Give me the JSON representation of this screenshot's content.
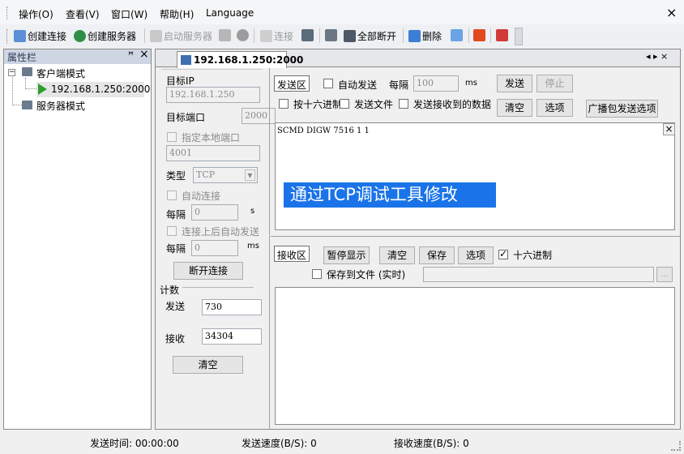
{
  "menu": {
    "items": [
      "操作(O)",
      "查看(V)",
      "窗口(W)",
      "帮助(H)",
      "Language"
    ],
    "close": "×"
  },
  "toolbar": {
    "create_connection": "创建连接",
    "create_server": "创建服务器",
    "start_server": "启动服务器",
    "connect": "连接",
    "disconnect_all": "全部断开",
    "delete": "删除"
  },
  "left_panel": {
    "title": "属性栏",
    "pin": "ꟸ",
    "close": "×",
    "client_mode": "客户端模式",
    "client_item": "192.168.1.250:2000",
    "server_mode": "服务器模式"
  },
  "tab": {
    "label": "192.168.1.250:2000",
    "nav": "◂ ▸ ×"
  },
  "connection": {
    "target_ip_label": "目标IP",
    "target_ip": "192.168.1.250",
    "target_port_label": "目标端口",
    "target_port": "2000",
    "local_port_label": "指定本地端口",
    "local_port": "4001",
    "type_label": "类型",
    "type_value": "TCP",
    "auto_connect_label": "自动连接",
    "interval_label": "每隔",
    "interval_value": "0",
    "interval_unit": "s",
    "auto_send_label": "连接上后自动发送",
    "interval2_label": "每隔",
    "interval2_value": "0",
    "interval2_unit": "ms",
    "disconnect_button": "断开连接"
  },
  "counters": {
    "title": "计数",
    "send_label": "发送",
    "send_value": "730",
    "recv_label": "接收",
    "recv_value": "34304",
    "clear_button": "清空"
  },
  "send_section": {
    "area_label": "发送区",
    "auto_send": "自动发送",
    "interval_label": "每隔",
    "interval_value": "100",
    "interval_unit": "ms",
    "send_button": "发送",
    "stop_button": "停止",
    "hex_send": "按十六进制",
    "send_file": "发送文件",
    "send_received": "发送接收到的数据",
    "clear_button": "清空",
    "options_button": "选项",
    "broadcast_button": "广播包发送选项",
    "content": "SCMD DIGW 7516 1 1",
    "overlay_text": "通过TCP调试工具修改"
  },
  "recv_section": {
    "area_label": "接收区",
    "pause_button": "暂停显示",
    "clear_button": "清空",
    "save_button": "保存",
    "options_button": "选项",
    "hex_label": "十六进制",
    "hex_checked": true,
    "save_to_file": "保存到文件 (实时)",
    "browse_button": "..."
  },
  "status": {
    "send_time": "发送时间: 00:00:00",
    "send_speed": "发送速度(B/S): 0",
    "recv_speed": "接收速度(B/S): 0"
  }
}
